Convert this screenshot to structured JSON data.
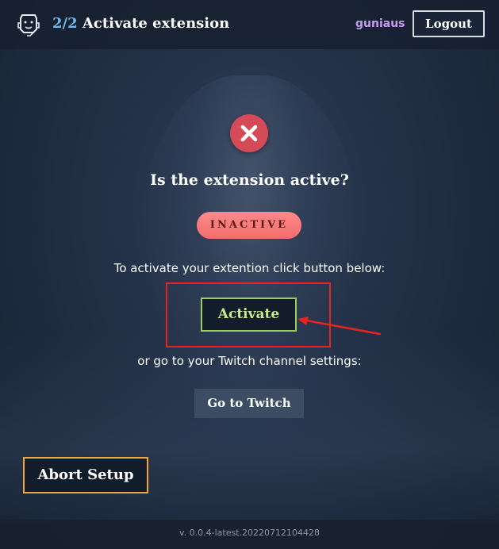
{
  "header": {
    "step": "2/2",
    "title": "Activate extension",
    "username": "guniaus",
    "logout_label": "Logout"
  },
  "status": {
    "question": "Is the extension active?",
    "badge": "INACTIVE",
    "badge_color": "#f26d6d",
    "icon": "close-icon"
  },
  "activation": {
    "instruction": "To activate your extention click button below:",
    "activate_label": "Activate",
    "alt_instruction": "or go to your Twitch channel settings:",
    "twitch_label": "Go to Twitch"
  },
  "abort_label": "Abort Setup",
  "footer": {
    "version": "v. 0.0.4-latest.20220712104428"
  },
  "colors": {
    "accent_step": "#6db9f2",
    "username": "#c89cf0",
    "activate_border": "#9ccc5b",
    "abort_border": "#f0a83a",
    "annotation": "#e8231f"
  }
}
